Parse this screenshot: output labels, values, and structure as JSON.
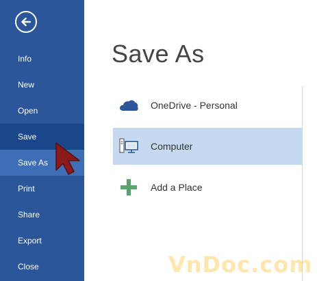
{
  "sidebar": {
    "items": [
      {
        "label": "Info"
      },
      {
        "label": "New"
      },
      {
        "label": "Open"
      },
      {
        "label": "Save"
      },
      {
        "label": "Save As"
      },
      {
        "label": "Print"
      },
      {
        "label": "Share"
      },
      {
        "label": "Export"
      },
      {
        "label": "Close"
      }
    ]
  },
  "main": {
    "title": "Save As",
    "places": [
      {
        "label": "OneDrive - Personal",
        "icon": "cloud-icon"
      },
      {
        "label": "Computer",
        "icon": "computer-icon"
      },
      {
        "label": "Add a Place",
        "icon": "plus-icon"
      }
    ]
  },
  "watermark": "VnDoc.com",
  "colors": {
    "sidebar": "#2b579a",
    "sidebar_hover": "#19478a",
    "sidebar_selected": "#3e6fb6",
    "place_selected": "#c5d9f1",
    "cloud": "#2b579a",
    "plus": "#5aa36b",
    "cursor": "#8b1a1a"
  }
}
